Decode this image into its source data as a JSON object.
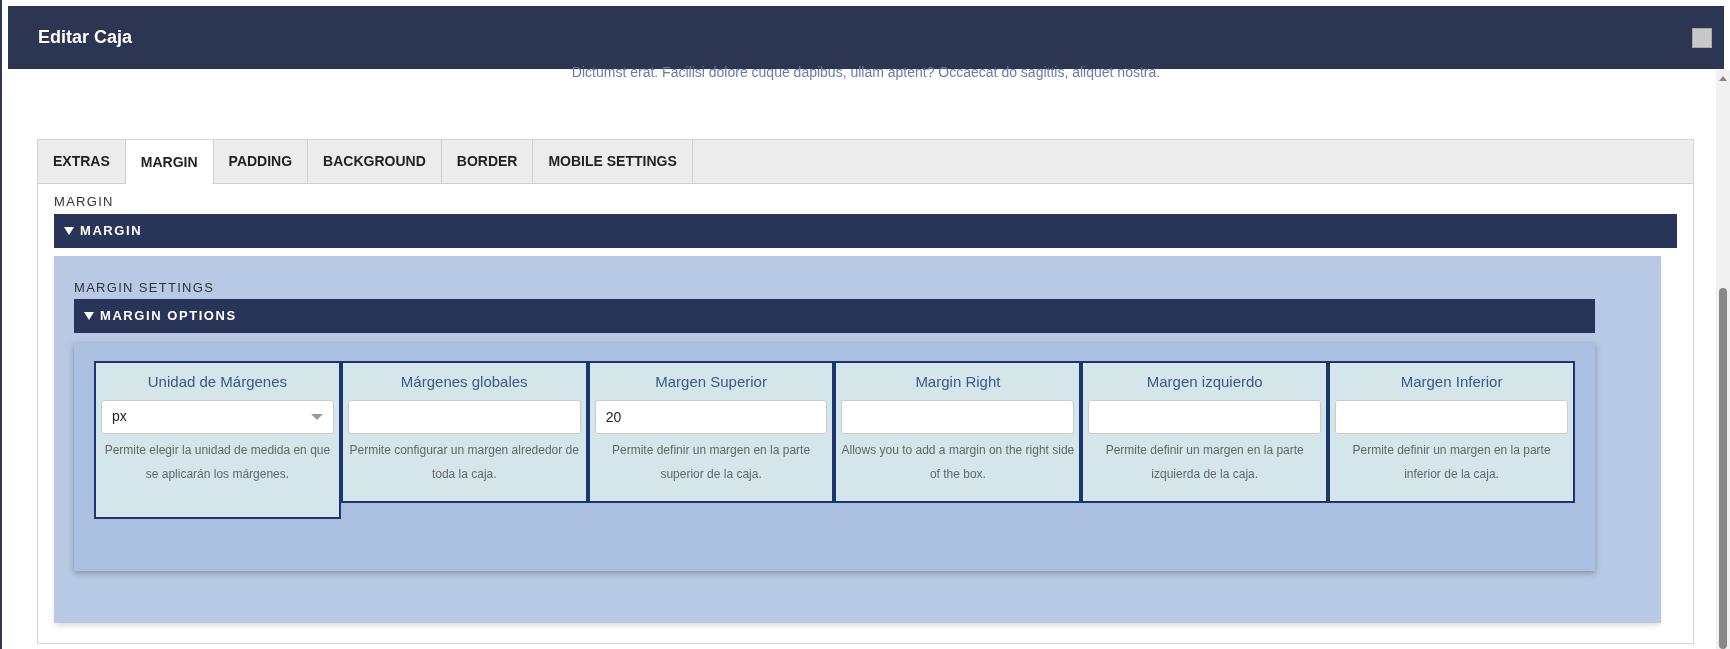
{
  "background_text": "Dictumst erat. Facilisi dolore cuque dapibus, ullam aptent? Occaecat do sagittis, aliquet nostra.",
  "window": {
    "title": "Editar Caja"
  },
  "tabs": [
    {
      "label": "EXTRAS",
      "selected": false
    },
    {
      "label": "MARGIN",
      "selected": true
    },
    {
      "label": "PADDING",
      "selected": false
    },
    {
      "label": "BACKGROUND",
      "selected": false
    },
    {
      "label": "BORDER",
      "selected": false
    },
    {
      "label": "MOBILE SETTINGS",
      "selected": false
    }
  ],
  "section_label": "MARGIN",
  "section_header": {
    "label": "MARGIN",
    "expanded": true
  },
  "settings_label": "MARGIN SETTINGS",
  "settings_header": {
    "label": "MARGIN OPTIONS",
    "expanded": true
  },
  "fields": [
    {
      "kind": "select",
      "label": "Unidad de Márgenes",
      "value": "px",
      "help": "Permite elegir la unidad de medida en que se aplicarán los márgenes."
    },
    {
      "kind": "text",
      "label": "Márgenes globales",
      "help": "Permite configurar un margen alrededor de toda la caja."
    },
    {
      "kind": "text",
      "label": "Margen Superior",
      "value": "20",
      "help": "Permite definir un margen en la parte superior de la caja."
    },
    {
      "kind": "text",
      "label": "Margin Right",
      "help": "Allows you to add a margin on the right side of the box."
    },
    {
      "kind": "text",
      "label": "Margen izquierdo",
      "help": "Permite definir un margen en la parte izquierda de la caja."
    },
    {
      "kind": "text",
      "label": "Margen Inferior",
      "help": "Permite definir un margen en la parte inferior de la caja."
    }
  ]
}
